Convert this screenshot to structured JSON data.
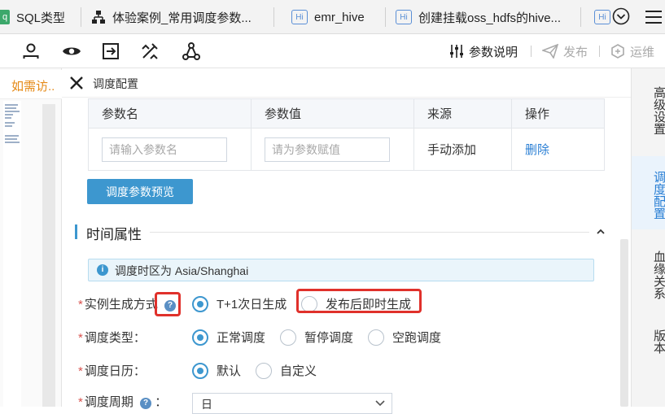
{
  "tabs": [
    {
      "label": "SQL类型",
      "badge": "q"
    },
    {
      "label": "体验案例_常用调度参数..."
    },
    {
      "label": "emr_hive",
      "badge": "Hi"
    },
    {
      "label": "创建挂载oss_hdfs的hive...",
      "badge": "Hi"
    },
    {
      "badge": "Hi"
    }
  ],
  "toolbar": {
    "param_doc_label": "参数说明",
    "publish_label": "发布",
    "ops_label": "运维"
  },
  "left": {
    "alert_tab": "如需访.."
  },
  "panel": {
    "title": "调度配置"
  },
  "params_table": {
    "headers": [
      "参数名",
      "参数值",
      "来源",
      "操作"
    ],
    "row": {
      "name_placeholder": "请输入参数名",
      "value_placeholder": "请为参数赋值",
      "source": "手动添加",
      "action": "删除"
    }
  },
  "preview_button": "调度参数预览",
  "time_section": {
    "title": "时间属性",
    "timezone_note": "调度时区为 Asia/Shanghai",
    "instance_mode": {
      "label": "实例生成方式",
      "options": [
        "T+1次日生成",
        "发布后即时生成"
      ],
      "selected": 0
    },
    "schedule_type": {
      "label": "调度类型：",
      "options": [
        "正常调度",
        "暂停调度",
        "空跑调度"
      ],
      "selected": 0
    },
    "schedule_calendar": {
      "label": "调度日历：",
      "options": [
        "默认",
        "自定义"
      ],
      "selected": 0
    },
    "schedule_cycle": {
      "label": "调度周期",
      "colon": "：",
      "value": "日"
    }
  },
  "right_nav": [
    {
      "label": "高级设置",
      "active": false
    },
    {
      "label": "调度配置",
      "active": true
    },
    {
      "label": "血缘关系",
      "active": false
    },
    {
      "label": "版本",
      "active": false
    }
  ],
  "colors": {
    "accent": "#3d97cf",
    "highlight_box": "#e0312b",
    "alert_text": "#e58a17"
  }
}
